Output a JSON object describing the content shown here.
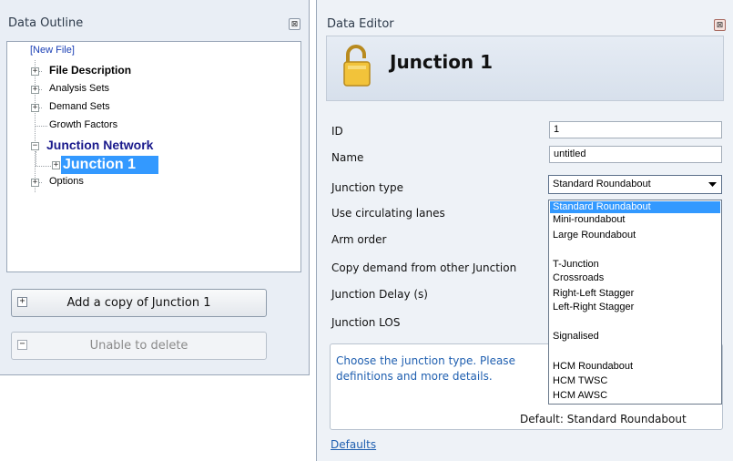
{
  "outline": {
    "title": "Data Outline",
    "close_icon": "⊠",
    "tree": {
      "new_file": "[New File]",
      "file_description": "File Description",
      "analysis_sets": "Analysis Sets",
      "demand_sets": "Demand Sets",
      "growth_factors": "Growth Factors",
      "junction_network": "Junction Network",
      "junction_1": "Junction 1",
      "options": "Options"
    },
    "add_copy_button": "Add a copy of Junction 1",
    "delete_button": "Unable to delete"
  },
  "editor": {
    "title": "Data Editor",
    "close_icon": "⊠",
    "heading": "Junction 1",
    "lock_icon": "unlocked-padlock",
    "fields": {
      "id_label": "ID",
      "id_value": "1",
      "name_label": "Name",
      "name_value": "untitled",
      "junction_type_label": "Junction type",
      "junction_type_value": "Standard Roundabout",
      "circulating_lanes_label": "Use circulating lanes",
      "arm_order_label": "Arm order",
      "copy_demand_label": "Copy demand from other Junction",
      "junction_delay_label": "Junction Delay (s)",
      "junction_los_label": "Junction LOS"
    },
    "dropdown_options": [
      "Standard Roundabout",
      "Mini-roundabout",
      "Large Roundabout",
      "T-Junction",
      "Crossroads",
      "Right-Left Stagger",
      "Left-Right Stagger",
      "Signalised",
      "HCM Roundabout",
      "HCM TWSC",
      "HCM AWSC"
    ],
    "help": {
      "line1": "Choose the junction type.  Please",
      "line2": "definitions and more details.",
      "default": "Default: Standard Roundabout"
    },
    "defaults_link": "Defaults"
  },
  "colors": {
    "selection": "#3399ff",
    "junction_network_text": "#1a1a8c",
    "help_text": "#1f5fb0"
  }
}
